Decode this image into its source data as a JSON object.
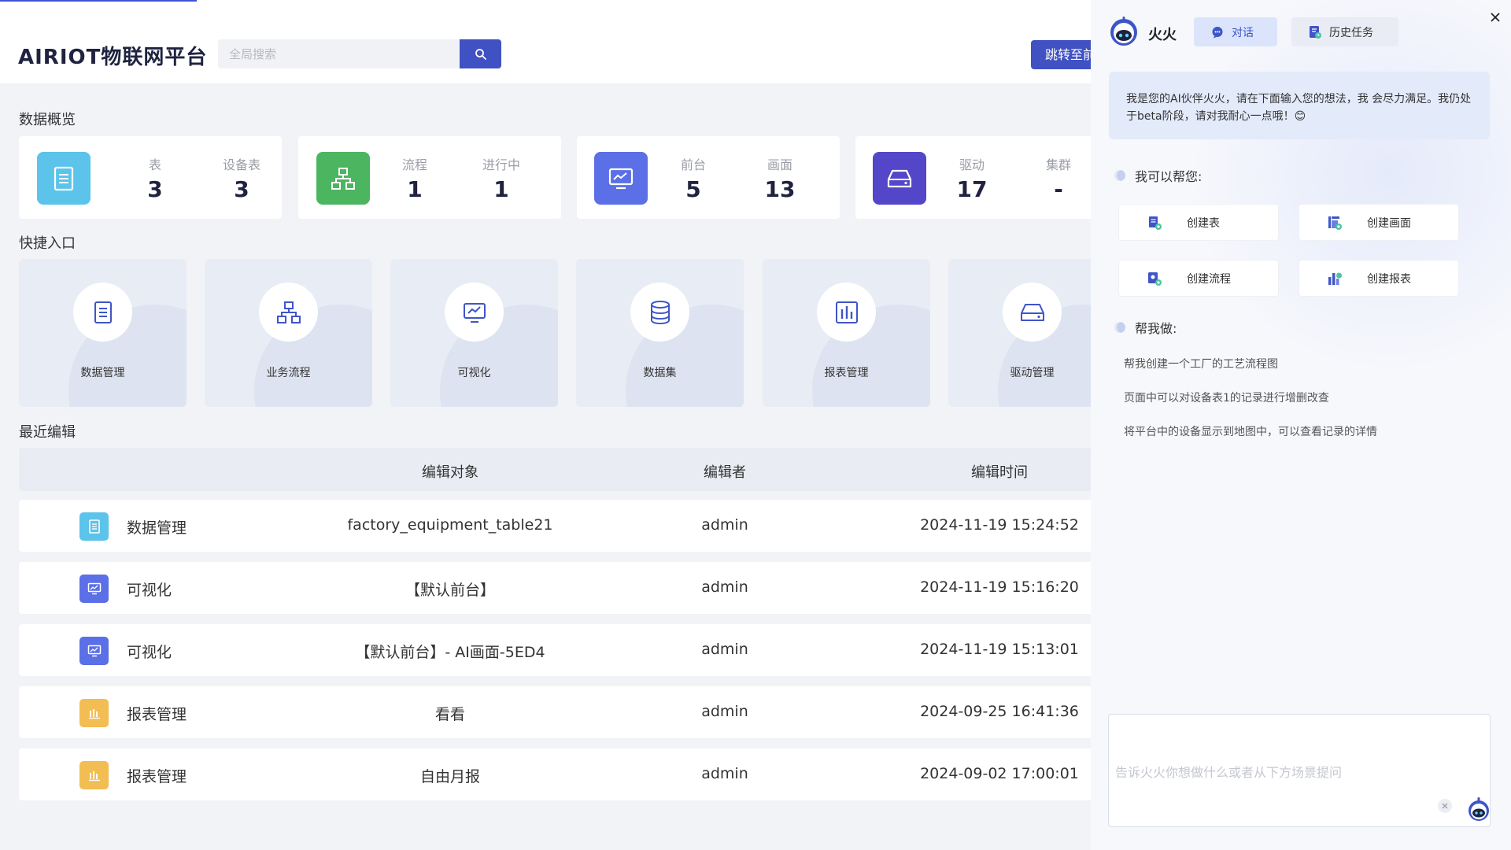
{
  "app": {
    "title": "AIRIOT物联网平台"
  },
  "search": {
    "placeholder": "全局搜索"
  },
  "header": {
    "jump_label": "跳转至前台"
  },
  "overview": {
    "title": "数据概览",
    "cards": [
      {
        "icon": "document-icon",
        "color": "#5cc3ea",
        "stats": [
          {
            "label": "表",
            "value": "3"
          },
          {
            "label": "设备表",
            "value": "3"
          }
        ]
      },
      {
        "icon": "flowchart-icon",
        "color": "#4cb55f",
        "stats": [
          {
            "label": "流程",
            "value": "1"
          },
          {
            "label": "进行中",
            "value": "1"
          }
        ]
      },
      {
        "icon": "monitor-icon",
        "color": "#5b6fe6",
        "stats": [
          {
            "label": "前台",
            "value": "5"
          },
          {
            "label": "画面",
            "value": "13"
          }
        ]
      },
      {
        "icon": "drive-icon",
        "color": "#5446c9",
        "stats": [
          {
            "label": "驱动",
            "value": "17"
          },
          {
            "label": "集群",
            "value": "-"
          }
        ]
      }
    ]
  },
  "quick": {
    "title": "快捷入口",
    "items": [
      {
        "label": "数据管理",
        "icon": "document-icon"
      },
      {
        "label": "业务流程",
        "icon": "flowchart-icon"
      },
      {
        "label": "可视化",
        "icon": "monitor-icon"
      },
      {
        "label": "数据集",
        "icon": "database-icon"
      },
      {
        "label": "报表管理",
        "icon": "bar-chart-icon"
      },
      {
        "label": "驱动管理",
        "icon": "drive-icon"
      }
    ]
  },
  "recent": {
    "title": "最近编辑",
    "columns": [
      "编辑对象",
      "编辑者",
      "编辑时间"
    ],
    "rows": [
      {
        "type": "数据管理",
        "icon": "document-icon",
        "color": "#5cc3ea",
        "object": "factory_equipment_table21",
        "editor": "admin",
        "time": "2024-11-19 15:24:52"
      },
      {
        "type": "可视化",
        "icon": "monitor-icon",
        "color": "#5b6fe6",
        "object": "【默认前台】",
        "editor": "admin",
        "time": "2024-11-19 15:16:20"
      },
      {
        "type": "可视化",
        "icon": "monitor-icon",
        "color": "#5b6fe6",
        "object": "【默认前台】- AI画面-5ED4",
        "editor": "admin",
        "time": "2024-11-19 15:13:01"
      },
      {
        "type": "报表管理",
        "icon": "bar-chart-icon",
        "color": "#f2bd52",
        "object": "看看",
        "editor": "admin",
        "time": "2024-09-25 16:41:36"
      },
      {
        "type": "报表管理",
        "icon": "bar-chart-icon",
        "color": "#f2bd52",
        "object": "自由月报",
        "editor": "admin",
        "time": "2024-09-02 17:00:01"
      }
    ]
  },
  "assistant": {
    "name": "火火",
    "tabs": [
      {
        "label": "对话",
        "icon": "chat-icon"
      },
      {
        "label": "历史任务",
        "icon": "history-icon"
      }
    ],
    "greeting": "我是您的AI伙伴火火，请在下面输入您的想法，我 会尽力满足。我仍处于beta阶段，请对我耐心一点哦！😊",
    "can_help_title": "我可以帮您:",
    "actions": [
      {
        "label": "创建表",
        "icon": "create-table-icon"
      },
      {
        "label": "创建画面",
        "icon": "create-screen-icon"
      },
      {
        "label": "创建流程",
        "icon": "create-flow-icon"
      },
      {
        "label": "创建报表",
        "icon": "create-report-icon"
      }
    ],
    "help_do_title": "帮我做:",
    "suggestions": [
      "帮我创建一个工厂的工艺流程图",
      "页面中可以对设备表1的记录进行增删改查",
      "将平台中的设备显示到地图中，可以查看记录的详情"
    ],
    "input_placeholder": "告诉火火你想做什么或者从下方场景提问"
  },
  "colors": {
    "primary": "#3f51c3",
    "tab_active_bg": "#dbe4fb",
    "text_dark": "#1f2340"
  }
}
